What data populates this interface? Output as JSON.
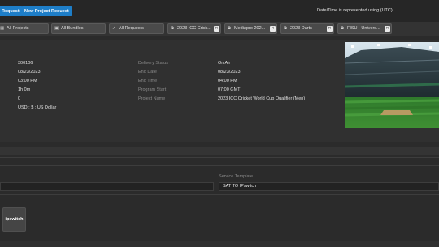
{
  "toolbar": {
    "request_button": "Request",
    "new_project_request_button": "New Project Request",
    "timezone_note": "Date/Time is represented using (UTC)"
  },
  "filters": [
    {
      "icon": "grid-icon",
      "label": "All Projects",
      "closable": false
    },
    {
      "icon": "bundle-icon",
      "label": "All Bundles",
      "closable": false
    },
    {
      "icon": "send-icon",
      "label": "All Requests",
      "closable": false
    },
    {
      "icon": "copy-icon",
      "label": "2023 ICC Crick...",
      "closable": true
    },
    {
      "icon": "copy-icon",
      "label": "Mediapro 202...",
      "closable": true
    },
    {
      "icon": "copy-icon",
      "label": "2023 Darts",
      "closable": true
    },
    {
      "icon": "copy-icon",
      "label": "FISU - Univers...",
      "closable": true
    }
  ],
  "details": {
    "left_values": [
      "300106",
      "08/23/2023",
      "03:00 PM",
      "1h 0m",
      "0",
      "USD : $ : US Dollar"
    ],
    "mid_labels": [
      "Delivery Status",
      "End Date",
      "End Time",
      "Program Start",
      "Project Name"
    ],
    "right_values": [
      "On Air",
      "08/23/2023",
      "04:00 PM",
      "07:00 GMT",
      "2023 ICC Cricket World Cup Qualifier (Men)"
    ]
  },
  "service": {
    "template_label": "Service Template",
    "template_value": "SAT TO IPswitch",
    "left_value": ""
  },
  "tile": {
    "label": "ipswitch"
  },
  "colors": {
    "accent": "#1e7ec8",
    "background": "#2b2b2b",
    "panel": "#303030"
  }
}
